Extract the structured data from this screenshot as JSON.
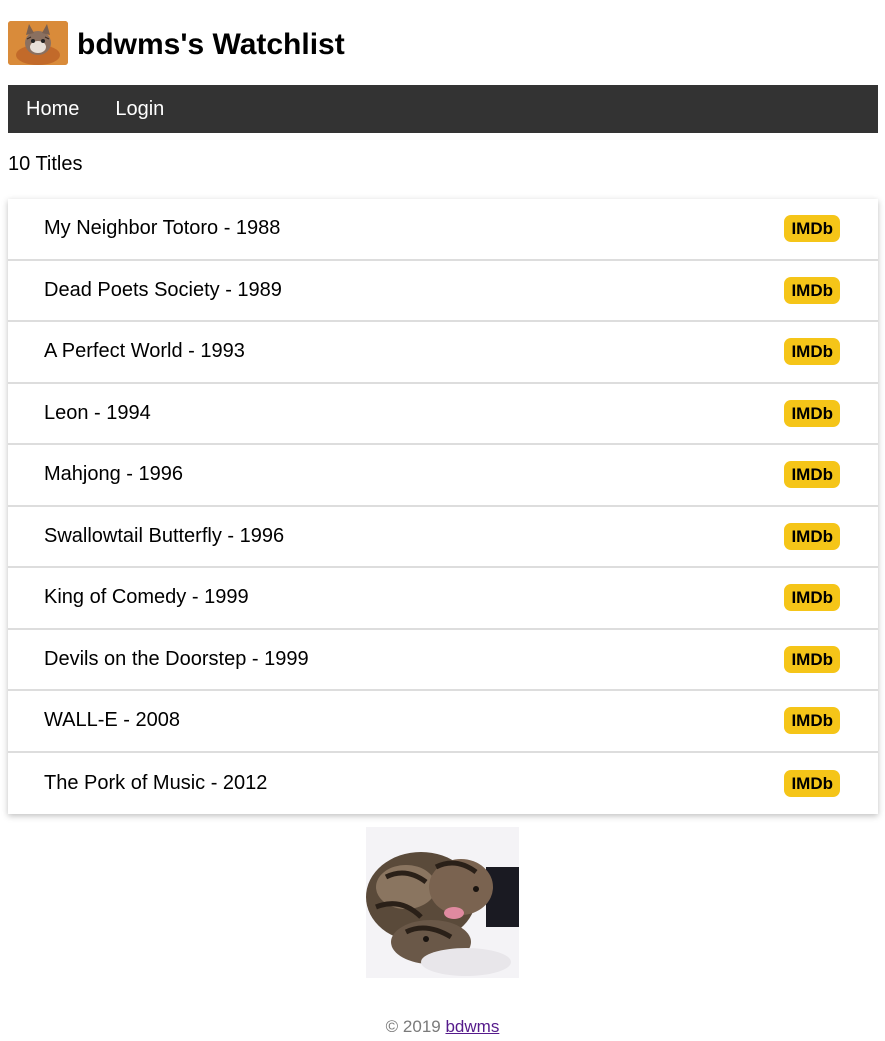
{
  "header": {
    "title": "bdwms's Watchlist"
  },
  "nav": {
    "items": [
      {
        "label": "Home"
      },
      {
        "label": "Login"
      }
    ]
  },
  "summary": {
    "count_text": "10 Titles"
  },
  "movies": [
    {
      "title": "My Neighbor Totoro - 1988",
      "badge": "IMDb"
    },
    {
      "title": "Dead Poets Society - 1989",
      "badge": "IMDb"
    },
    {
      "title": "A Perfect World - 1993",
      "badge": "IMDb"
    },
    {
      "title": "Leon - 1994",
      "badge": "IMDb"
    },
    {
      "title": "Mahjong - 1996",
      "badge": "IMDb"
    },
    {
      "title": "Swallowtail Butterfly - 1996",
      "badge": "IMDb"
    },
    {
      "title": "King of Comedy - 1999",
      "badge": "IMDb"
    },
    {
      "title": "Devils on the Doorstep - 1999",
      "badge": "IMDb"
    },
    {
      "title": "WALL-E - 2008",
      "badge": "IMDb"
    },
    {
      "title": "The Pork of Music - 2012",
      "badge": "IMDb"
    }
  ],
  "footer": {
    "copyright": "© 2019 ",
    "author_link": "bdwms"
  },
  "colors": {
    "nav_bg": "#333333",
    "imdb_badge": "#f5c518"
  }
}
